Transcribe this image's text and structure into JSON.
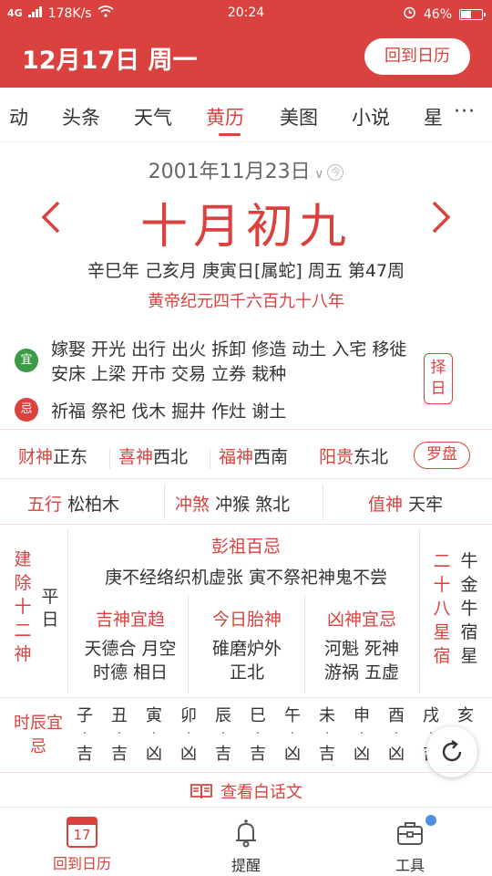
{
  "status_bar": {
    "network": "4G",
    "speed": "178K/s",
    "time": "20:24",
    "battery": "46%"
  },
  "header": {
    "date_title": "12月17日 周一",
    "back_button": "回到日历"
  },
  "tabs": {
    "items": [
      "动",
      "头条",
      "天气",
      "黄历",
      "美图",
      "小说",
      "星"
    ],
    "active": "黄历",
    "more": "···"
  },
  "almanac": {
    "solar_date": "2001年11月23日",
    "lunar_date": "十月初九",
    "ganzhi": "辛巳年 己亥月 庚寅日[属蛇] 周五 第47周",
    "huangdi": "黄帝纪元四千六百九十八年",
    "yi_icon": "宜",
    "yi_text": "嫁娶 开光 出行 出火 拆卸 修造 动土 入宅 移徙 安床 上梁 开市 交易 立券 栽种",
    "ji_icon": "忌",
    "ji_text": "祈福 祭祀 伐木 掘井 作灶 谢土",
    "zeri_button": "择日"
  },
  "gods": {
    "caishen_label": "财神",
    "caishen_value": "正东",
    "xishen_label": "喜神",
    "xishen_value": "西北",
    "fushen_label": "福神",
    "fushen_value": "西南",
    "yanggui_label": "阳贵",
    "yanggui_value": "东北",
    "luopan_button": "罗盘"
  },
  "row3": {
    "wuxing_label": "五行",
    "wuxing_value": "松柏木",
    "chongsha_label": "冲煞",
    "chongsha_value": "冲猴 煞北",
    "zhishen_label": "值神",
    "zhishen_value": "天牢"
  },
  "details": {
    "jianchu_label": "建除十二神",
    "jianchu_value": "平日",
    "pengzu_title": "彭祖百忌",
    "pengzu_text": "庚不经络织机虚张 寅不祭祀神鬼不尝",
    "jishen_title": "吉神宜趋",
    "jishen_text_1": "天德合 月空",
    "jishen_text_2": "时德 相日",
    "taishen_title": "今日胎神",
    "taishen_text_1": "碓磨炉外",
    "taishen_text_2": "正北",
    "xiongshen_title": "凶神宜忌",
    "xiongshen_text_1": "河魁 死神",
    "xiongshen_text_2": "游祸 五虚",
    "xiu_label": "二十八星宿",
    "xiu_value": "牛金牛宿星"
  },
  "hours": {
    "label": "时辰宜忌",
    "items": [
      {
        "zhi": "子",
        "luck": "吉"
      },
      {
        "zhi": "丑",
        "luck": "吉"
      },
      {
        "zhi": "寅",
        "luck": "凶"
      },
      {
        "zhi": "卯",
        "luck": "凶"
      },
      {
        "zhi": "辰",
        "luck": "吉"
      },
      {
        "zhi": "巳",
        "luck": "吉"
      },
      {
        "zhi": "午",
        "luck": "凶"
      },
      {
        "zhi": "未",
        "luck": "吉"
      },
      {
        "zhi": "申",
        "luck": "凶"
      },
      {
        "zhi": "酉",
        "luck": "凶"
      },
      {
        "zhi": "戌",
        "luck": "吉"
      },
      {
        "zhi": "亥",
        "luck": "凶"
      }
    ]
  },
  "baihua_link": "查看白话文",
  "bottom_nav": {
    "calendar_day": "17",
    "calendar_label": "回到日历",
    "remind_label": "提醒",
    "tools_label": "工具"
  },
  "colors": {
    "brand": "#d9423e",
    "yi_green": "#3b9a45",
    "notification_blue": "#4e8fe6"
  }
}
